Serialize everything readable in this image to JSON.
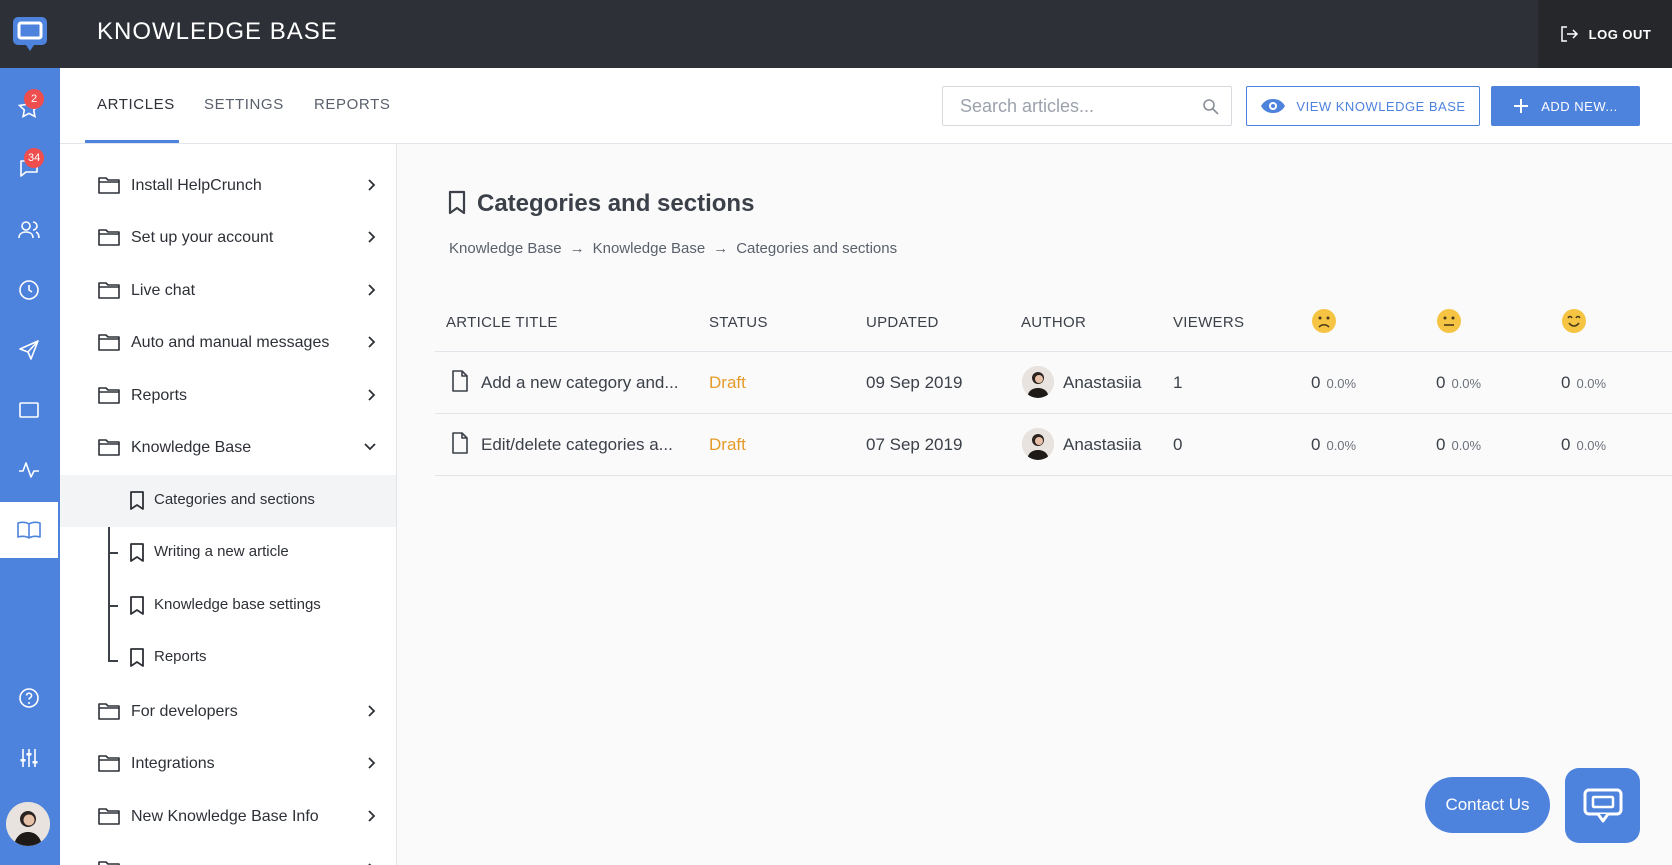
{
  "app": {
    "title": "KNOWLEDGE BASE",
    "logout_label": "LOG OUT"
  },
  "rail": {
    "items": [
      {
        "icon": "star-icon",
        "badge": "2"
      },
      {
        "icon": "chat-icon",
        "badge": "34"
      },
      {
        "icon": "contacts-icon",
        "badge": ""
      },
      {
        "icon": "clock-icon",
        "badge": ""
      },
      {
        "icon": "send-icon",
        "badge": ""
      },
      {
        "icon": "screen-icon",
        "badge": ""
      },
      {
        "icon": "activity-icon",
        "badge": ""
      },
      {
        "icon": "book-icon",
        "badge": ""
      },
      {
        "icon": "help-icon",
        "badge": ""
      },
      {
        "icon": "sliders-icon",
        "badge": ""
      }
    ]
  },
  "tabs": {
    "articles": "ARTICLES",
    "settings": "SETTINGS",
    "reports": "REPORTS"
  },
  "search": {
    "placeholder": "Search articles..."
  },
  "actions": {
    "view_kb": "VIEW KNOWLEDGE BASE",
    "add_new": "ADD NEW..."
  },
  "tree": {
    "folders": [
      "Install HelpCrunch",
      "Set up your account",
      "Live chat",
      "Auto and manual messages",
      "Reports",
      "Knowledge Base"
    ],
    "subsections": [
      "Categories and sections",
      "Writing a new article",
      "Knowledge base settings",
      "Reports"
    ],
    "folders_after": [
      "For developers",
      "Integrations",
      "New Knowledge Base Info"
    ]
  },
  "main": {
    "title": "Categories and sections",
    "breadcrumb": [
      "Knowledge Base",
      "→",
      "Knowledge Base",
      "→",
      "Categories and sections"
    ],
    "columns": {
      "title": "ARTICLE TITLE",
      "status": "STATUS",
      "updated": "UPDATED",
      "author": "AUTHOR",
      "viewers": "VIEWERS"
    },
    "rows": [
      {
        "title": "Add a new category and...",
        "status": "Draft",
        "updated": "09 Sep 2019",
        "author": "Anastasiia",
        "viewers": "1",
        "sad": "0",
        "sad_pct": "0.0%",
        "neutral": "0",
        "neutral_pct": "0.0%",
        "happy": "0",
        "happy_pct": "0.0%"
      },
      {
        "title": "Edit/delete categories a...",
        "status": "Draft",
        "updated": "07 Sep 2019",
        "author": "Anastasiia",
        "viewers": "0",
        "sad": "0",
        "sad_pct": "0.0%",
        "neutral": "0",
        "neutral_pct": "0.0%",
        "happy": "0",
        "happy_pct": "0.0%"
      }
    ]
  },
  "widget": {
    "contact_label": "Contact Us"
  },
  "colors": {
    "accent": "#4d82dd",
    "topbar": "#2d3036",
    "draft": "#e59b29",
    "badge": "#ef4e4e"
  }
}
